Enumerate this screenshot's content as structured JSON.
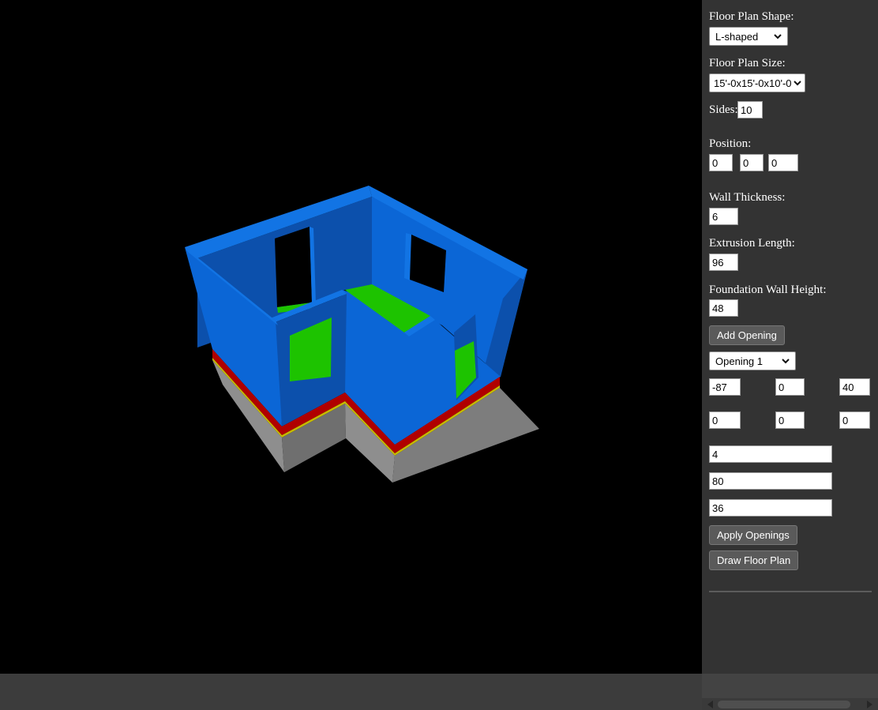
{
  "panel": {
    "shape": {
      "label": "Floor Plan Shape:",
      "value": "L-shaped"
    },
    "size": {
      "label": "Floor Plan Size:",
      "value": "15'-0x15'-0x10'-0"
    },
    "sides": {
      "label": "Sides:",
      "value": "10"
    },
    "position": {
      "label": "Position:",
      "values": [
        "0",
        "0",
        "0"
      ]
    },
    "wall_thickness": {
      "label": "Wall Thickness:",
      "value": "6"
    },
    "extrusion_length": {
      "label": "Extrusion Length:",
      "value": "96"
    },
    "foundation_wall_height": {
      "label": "Foundation Wall Height:",
      "value": "48"
    },
    "add_opening_button": "Add Opening",
    "opening_select": {
      "value": "Opening 1"
    },
    "opening_row1": [
      "-87",
      "0",
      "40"
    ],
    "opening_row2": [
      "0",
      "0",
      "0"
    ],
    "opening_row3": [
      "4",
      "80",
      "36"
    ],
    "apply_openings_button": "Apply Openings",
    "draw_floor_plan_button": "Draw Floor Plan"
  },
  "ui_colors": {
    "panel_bg": "#333333",
    "viewport_bg": "#000000",
    "bottom_strip": "#3c3c3c",
    "scroll_thumb": "#4f4f4f",
    "button_bg": "#5a5a5a",
    "label_text": "#ffffff"
  },
  "model_colors": {
    "wall_lit": "#0b66d6",
    "wall_shade": "#0c50ac",
    "wall_rim": "#1274e4",
    "floor_green": "#1dc300",
    "band_red": "#b00000",
    "band_yellow": "#c6ba00",
    "foundation_lit": "#8e8e8e",
    "foundation_shade": "#6f6f6f",
    "foundation_front": "#7d7d7d",
    "opening_black": "#000000"
  }
}
